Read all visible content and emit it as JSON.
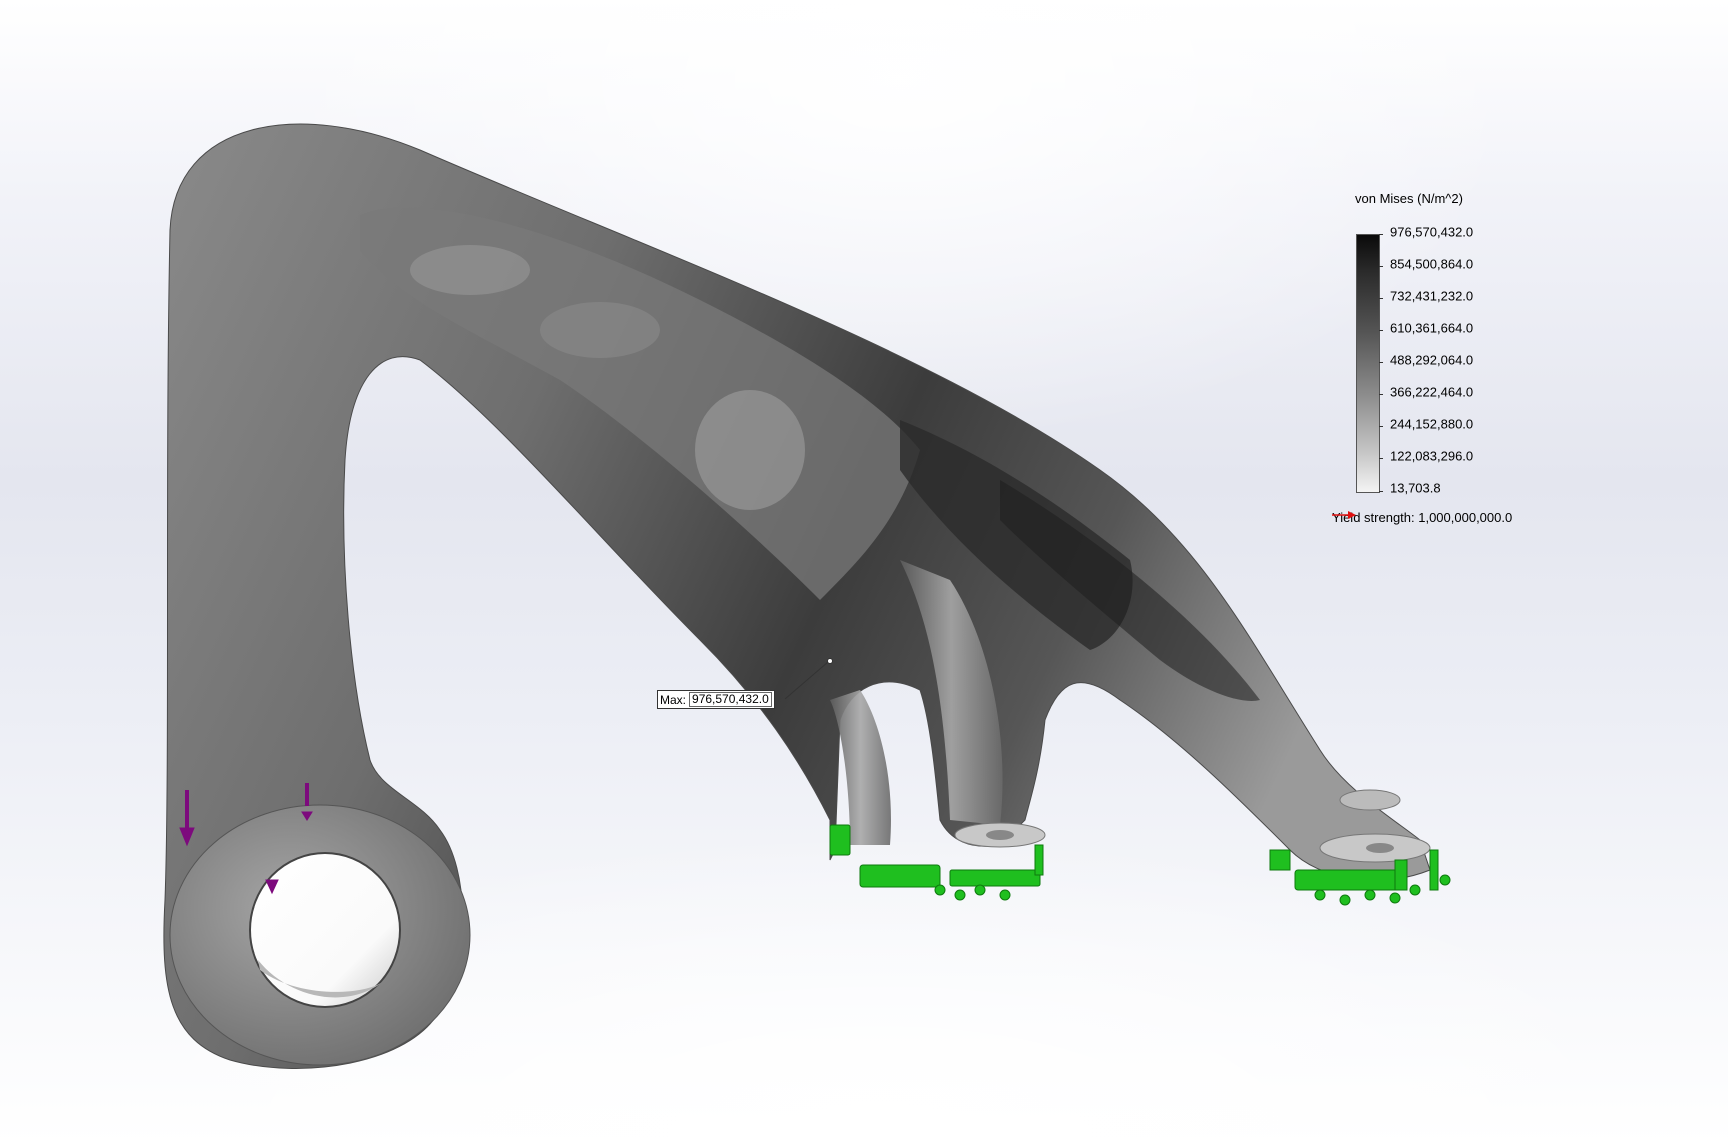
{
  "legend": {
    "title": "von Mises (N/m^2)",
    "ticks": [
      "976,570,432.0",
      "854,500,864.0",
      "732,431,232.0",
      "610,361,664.0",
      "488,292,064.0",
      "366,222,464.0",
      "244,152,880.0",
      "122,083,296.0",
      "13,703.8"
    ],
    "yield_label": "Yield strength: 1,000,000,000.0",
    "colormap": [
      "#f4f4f4",
      "#0a0a0a"
    ]
  },
  "probe": {
    "label": "Max:",
    "value": "976,570,432.0"
  },
  "colors": {
    "fixture": "#1fbf1f",
    "load_arrow": "#7d0a7d",
    "yield_arrow": "#e01010"
  },
  "icons": [
    "fixture-icon",
    "force-arrow-icon"
  ]
}
